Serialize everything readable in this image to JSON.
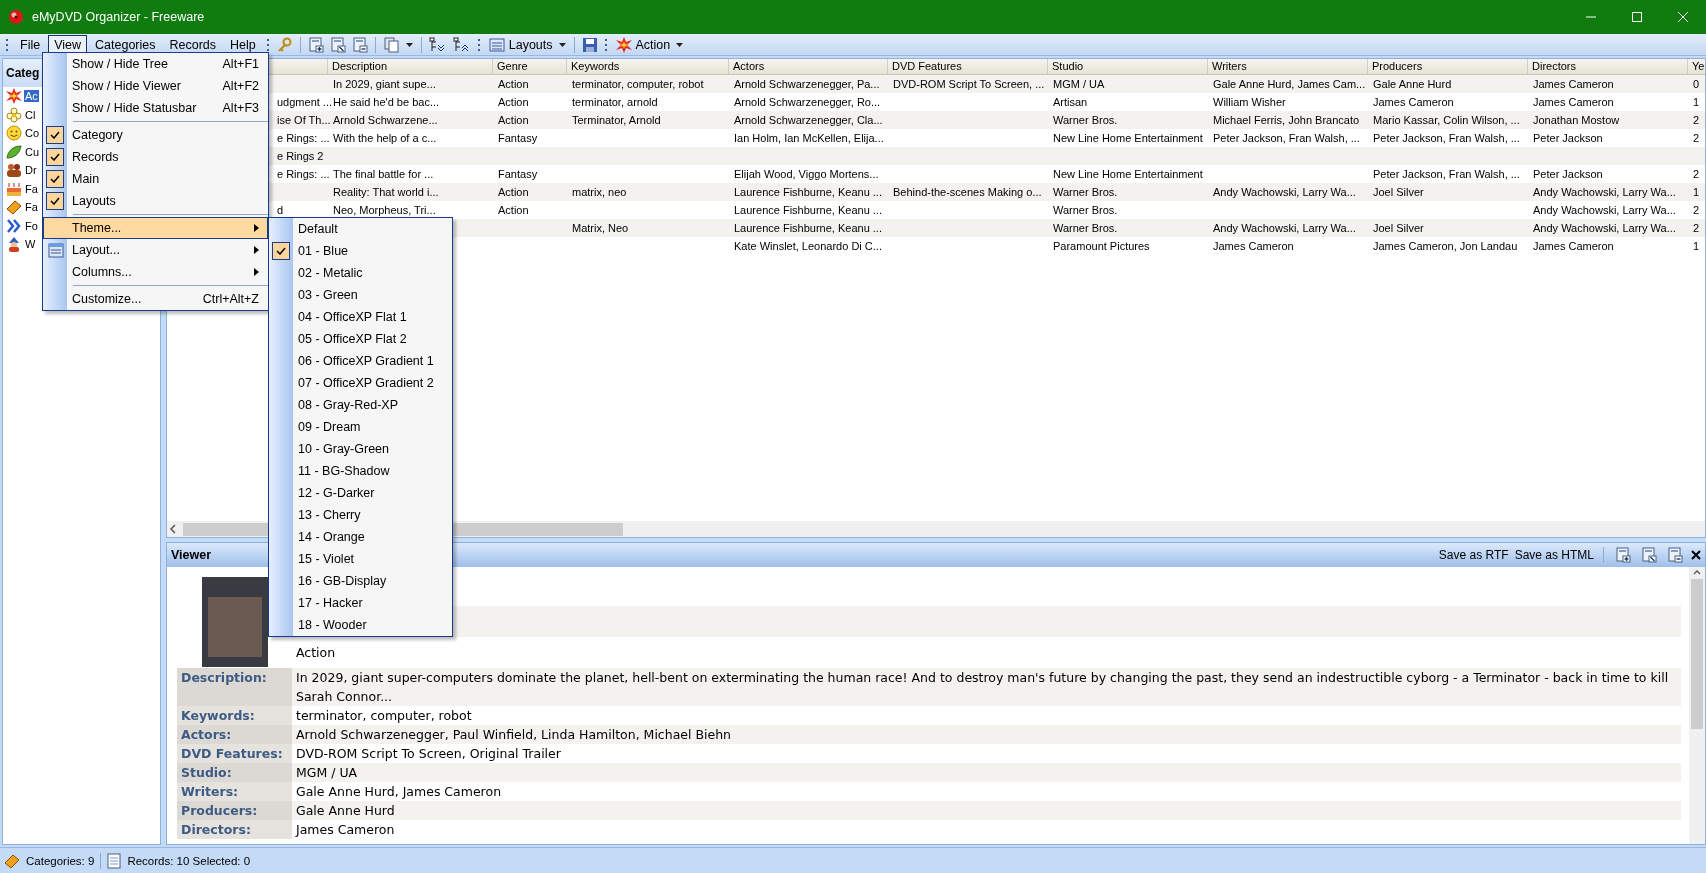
{
  "window": {
    "title": "eMyDVD Organizer - Freeware"
  },
  "menu_bar": [
    {
      "label": "File",
      "selected": false
    },
    {
      "label": "View",
      "selected": true
    },
    {
      "label": "Categories",
      "selected": false
    },
    {
      "label": "Records",
      "selected": false
    },
    {
      "label": "Help",
      "selected": false
    }
  ],
  "toolbar": {
    "layouts_button": "Layouts",
    "action_button": "Action"
  },
  "categories_panel": {
    "title": "Categ",
    "items": [
      {
        "label": "Ac",
        "selected": true
      },
      {
        "label": "Cl",
        "selected": false
      },
      {
        "label": "Co",
        "selected": false
      },
      {
        "label": "Cu",
        "selected": false
      },
      {
        "label": "Dr",
        "selected": false
      },
      {
        "label": "Fa",
        "selected": false
      },
      {
        "label": "Fa",
        "selected": false
      },
      {
        "label": "Fo",
        "selected": false
      },
      {
        "label": "W",
        "selected": false
      }
    ]
  },
  "table": {
    "columns": [
      "Description",
      "Genre",
      "Keywords",
      "Actors",
      "DVD Features",
      "Studio",
      "Writers",
      "Producers",
      "Directors",
      "Ye"
    ],
    "rows": [
      {
        "cells": [
          "In 2029, giant supe...",
          "Action",
          "terminator, computer, robot",
          "Arnold Schwarzenegger, Pa...",
          "DVD-ROM Script To Screen, ...",
          "MGM / UA",
          "Gale Anne Hurd, James Cam...",
          "Gale Anne Hurd",
          "James Cameron",
          "0"
        ]
      },
      {
        "title": "udgment ...",
        "cells": [
          "He said he'd be bac...",
          "Action",
          "terminator, arnold",
          "Arnold Schwarzenegger, Ro...",
          null,
          "Artisan",
          "William Wisher",
          "James Cameron",
          "James Cameron",
          "1"
        ]
      },
      {
        "title": "ise Of Th...",
        "cells": [
          "Arnold Schwarzene...",
          "Action",
          "Terminator, Arnold",
          "Arnold Schwarzenegger, Cla...",
          null,
          "Warner Bros.",
          "Michael Ferris, John Brancato",
          "Mario Kassar, Colin Wilson, ...",
          "Jonathan Mostow",
          "2"
        ]
      },
      {
        "title": "e Rings: ...",
        "cells": [
          "With the help of a c...",
          "Fantasy",
          null,
          "Ian Holm, Ian McKellen, Elija...",
          null,
          "New Line Home Entertainment",
          "Peter Jackson, Fran Walsh, ...",
          "Peter Jackson, Fran Walsh, ...",
          "Peter Jackson",
          "2"
        ]
      },
      {
        "title": "e Rings 2",
        "cells": [
          null,
          null,
          null,
          null,
          null,
          null,
          null,
          null,
          null,
          null
        ]
      },
      {
        "title": "e Rings: ...",
        "cells": [
          "The final battle for ...",
          "Fantasy",
          null,
          "Elijah Wood, Viggo Mortens...",
          null,
          "New Line Home Entertainment",
          null,
          "Peter Jackson, Fran Walsh, ...",
          "Peter Jackson",
          "2"
        ]
      },
      {
        "cells": [
          "Reality: That world i...",
          "Action",
          "matrix, neo",
          "Laurence Fishburne, Keanu ...",
          "Behind-the-scenes Making o...",
          "Warner Bros.",
          "Andy Wachowski, Larry Wa...",
          "Joel Silver",
          "Andy Wachowski, Larry Wa...",
          "1"
        ]
      },
      {
        "title": "d",
        "cells": [
          "Neo, Morpheus, Tri...",
          "Action",
          null,
          "Laurence Fishburne, Keanu ...",
          null,
          "Warner Bros.",
          null,
          null,
          "Andy Wachowski, Larry Wa...",
          "2"
        ]
      },
      {
        "cells": [
          null,
          null,
          "Matrix, Neo",
          "Laurence Fishburne, Keanu ...",
          null,
          "Warner Bros.",
          "Andy Wachowski, Larry Wa...",
          "Joel Silver",
          "Andy Wachowski, Larry Wa...",
          "2"
        ]
      },
      {
        "cells": [
          null,
          null,
          null,
          "Kate Winslet, Leonardo Di C...",
          null,
          "Paramount Pictures",
          "James Cameron",
          "James Cameron, Jon Landau",
          "James Cameron",
          "1"
        ]
      }
    ]
  },
  "viewer": {
    "title": "Viewer",
    "actions": [
      "Save as RTF",
      "Save as HTML"
    ],
    "genre_value": "Action",
    "fields": [
      {
        "label": "Description:",
        "value": "In 2029, giant super-computers dominate the planet, hell-bent on exterminating the human race! And to destroy man's future by changing the past, they send an indestructible cyborg - a Terminator - back in time to kill Sarah Connor..."
      },
      {
        "label": "Keywords:",
        "value": "terminator, computer, robot"
      },
      {
        "label": "Actors:",
        "value": "Arnold Schwarzenegger, Paul Winfield, Linda Hamilton, Michael Biehn"
      },
      {
        "label": "DVD Features:",
        "value": "DVD-ROM Script To Screen, Original Trailer"
      },
      {
        "label": "Studio:",
        "value": "MGM / UA"
      },
      {
        "label": "Writers:",
        "value": "Gale Anne Hurd, James Cameron"
      },
      {
        "label": "Producers:",
        "value": "Gale Anne Hurd"
      },
      {
        "label": "Directors:",
        "value": "James Cameron"
      }
    ]
  },
  "view_menu": {
    "items": [
      {
        "kind": "command",
        "label": "Show / Hide Tree",
        "shortcut": "Alt+F1",
        "selected": false
      },
      {
        "kind": "command",
        "label": "Show / Hide Viewer",
        "shortcut": "Alt+F2",
        "selected": false
      },
      {
        "kind": "command",
        "label": "Show / Hide Statusbar",
        "shortcut": "Alt+F3",
        "selected": false
      },
      {
        "kind": "separator"
      },
      {
        "kind": "toggle",
        "label": "Category",
        "checked": true,
        "selected": false
      },
      {
        "kind": "toggle",
        "label": "Records",
        "checked": true,
        "selected": false
      },
      {
        "kind": "toggle",
        "label": "Main",
        "checked": true,
        "selected": false
      },
      {
        "kind": "toggle",
        "label": "Layouts",
        "checked": true,
        "selected": false
      },
      {
        "kind": "separator"
      },
      {
        "kind": "submenu",
        "label": "Theme...",
        "selected": true
      },
      {
        "kind": "submenu",
        "label": "Layout...",
        "has_icon": true,
        "selected": false
      },
      {
        "kind": "submenu",
        "label": "Columns...",
        "selected": false
      },
      {
        "kind": "separator"
      },
      {
        "kind": "command",
        "label": "Customize...",
        "shortcut": "Ctrl+Alt+Z",
        "selected": false
      }
    ]
  },
  "theme_menu": {
    "items": [
      {
        "label": "Default",
        "checked": false
      },
      {
        "label": "01 - Blue",
        "checked": true
      },
      {
        "label": "02 - Metalic",
        "checked": false
      },
      {
        "label": "03 - Green",
        "checked": false
      },
      {
        "label": "04 - OfficeXP Flat 1",
        "checked": false
      },
      {
        "label": "05 - OfficeXP Flat 2",
        "checked": false
      },
      {
        "label": "06 - OfficeXP Gradient 1",
        "checked": false
      },
      {
        "label": "07 - OfficeXP Gradient 2",
        "checked": false
      },
      {
        "label": "08 - Gray-Red-XP",
        "checked": false
      },
      {
        "label": "09 - Dream",
        "checked": false
      },
      {
        "label": "10 - Gray-Green",
        "checked": false
      },
      {
        "label": "11 - BG-Shadow",
        "checked": false
      },
      {
        "label": "12 - G-Darker",
        "checked": false
      },
      {
        "label": "13 - Cherry",
        "checked": false
      },
      {
        "label": "14 - Orange",
        "checked": false
      },
      {
        "label": "15 - Violet",
        "checked": false
      },
      {
        "label": "16 - GB-Display",
        "checked": false
      },
      {
        "label": "17 - Hacker",
        "checked": false
      },
      {
        "label": "18 - Wooder",
        "checked": false
      }
    ]
  },
  "status_bar": {
    "categories": "Categories: 9",
    "records": "Records: 10 Selected: 0"
  }
}
